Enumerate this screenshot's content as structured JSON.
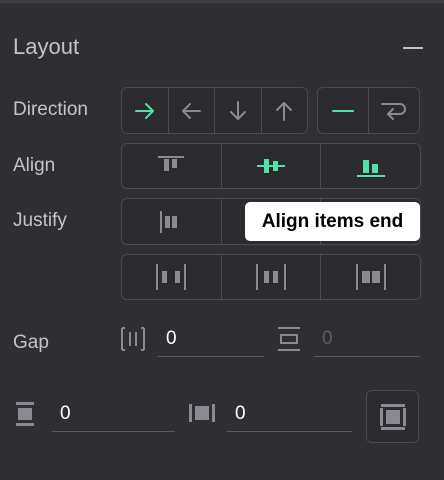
{
  "section": {
    "title": "Layout"
  },
  "direction": {
    "label": "Direction",
    "options": [
      "right-arrow-icon",
      "left-arrow-icon",
      "down-arrow-icon",
      "up-arrow-icon"
    ],
    "wrap_options": [
      "no-wrap-icon",
      "wrap-icon"
    ],
    "selected": "right-arrow-icon"
  },
  "align": {
    "label": "Align",
    "options": [
      "align-start-icon",
      "align-center-icon",
      "align-end-icon"
    ]
  },
  "justify": {
    "label": "Justify",
    "tooltip": "Align items end"
  },
  "gap": {
    "label": "Gap",
    "column_value": "0",
    "row_value": "0"
  },
  "padding": {
    "vertical_value": "0",
    "horizontal_value": "0"
  },
  "colors": {
    "accent": "#4fe3a5",
    "icon": "#8a8a92",
    "background": "#2e2e33"
  }
}
